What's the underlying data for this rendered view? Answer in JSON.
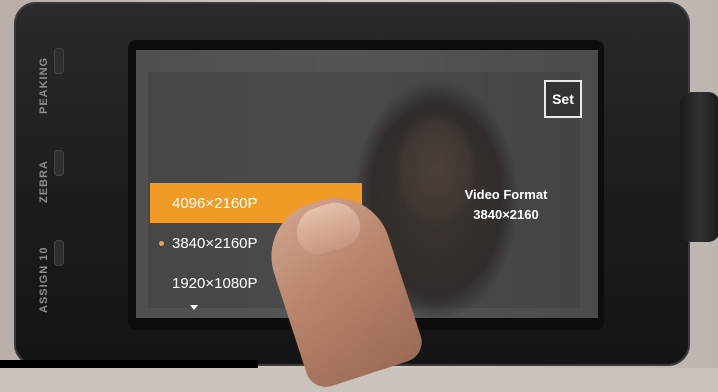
{
  "side_buttons": [
    "PEAKING",
    "ZEBRA",
    "ASSIGN 10"
  ],
  "screen": {
    "set_label": "Set",
    "info_title": "Video Format",
    "info_value": "3840×2160",
    "options": [
      {
        "label": "4096×2160P",
        "state": "highlighted"
      },
      {
        "label": "3840×2160P",
        "state": "current"
      },
      {
        "label": "1920×1080P",
        "state": "normal"
      }
    ],
    "scroll_icon": "down-arrow-icon"
  },
  "colors": {
    "accent": "#f09b26",
    "current_dot": "#f0a23a"
  }
}
